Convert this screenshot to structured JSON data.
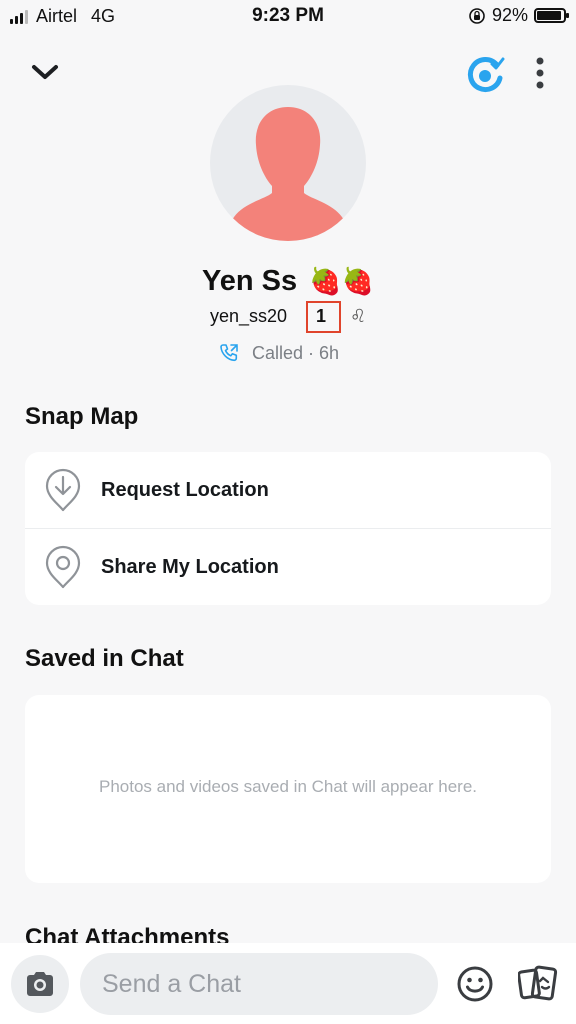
{
  "status_bar": {
    "carrier": "Airtel",
    "network": "4G",
    "time": "9:23 PM",
    "battery": "92%",
    "battery_level": 0.92
  },
  "header": {
    "collapse_icon": "chevron-down-icon",
    "bitmoji_icon": "bitmoji-check-icon",
    "more_icon": "more-vertical-icon"
  },
  "profile": {
    "name": "Yen Ss",
    "name_emoji": "🍓🍓",
    "username": "yen_ss20",
    "snap_score": "1",
    "zodiac": "♌",
    "call_status": "Called · 6h",
    "avatar_color": "#f3827a"
  },
  "snap_map": {
    "title": "Snap Map",
    "items": [
      {
        "label": "Request Location",
        "icon": "location-download-icon"
      },
      {
        "label": "Share My Location",
        "icon": "location-pin-icon"
      }
    ]
  },
  "saved_in_chat": {
    "title": "Saved in Chat",
    "empty_text": "Photos and videos saved in Chat will appear here."
  },
  "chat_attachments": {
    "title": "Chat Attachments"
  },
  "bottom_bar": {
    "placeholder": "Send a Chat"
  },
  "colors": {
    "accent_blue": "#2aa4ee",
    "highlight_red": "#e0442c"
  }
}
